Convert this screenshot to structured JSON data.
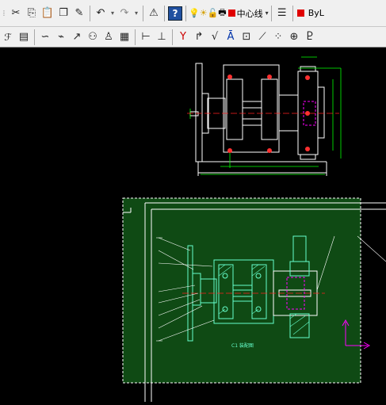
{
  "toolbar1": {
    "buttons": [
      "cut-icon",
      "copy-icon",
      "paste-icon",
      "clipboard-icon",
      "match-properties-icon",
      "undo-icon",
      "redo-icon",
      "adcenter-icon",
      "help-icon"
    ],
    "layer_combo_value": "中心线",
    "color_combo_value": "ByL",
    "layer_color": "#e00000"
  },
  "toolbar2": {
    "buttons": [
      "spline-icon",
      "break-line-icon",
      "leader-icon",
      "balloon-icon",
      "user-block-icon",
      "title-block-icon",
      "dimension-icon",
      "coordinate-dim-icon",
      "chamfer-icon",
      "angle-icon",
      "check-icon",
      "datum-icon",
      "tolerance-icon",
      "wave-icon",
      "center-mark-icon",
      "weld-icon",
      "table-icon"
    ]
  },
  "canvas": {
    "background": "#000000",
    "selection_fill": "#0f4a14",
    "drawing_label": "C1 装配图"
  }
}
